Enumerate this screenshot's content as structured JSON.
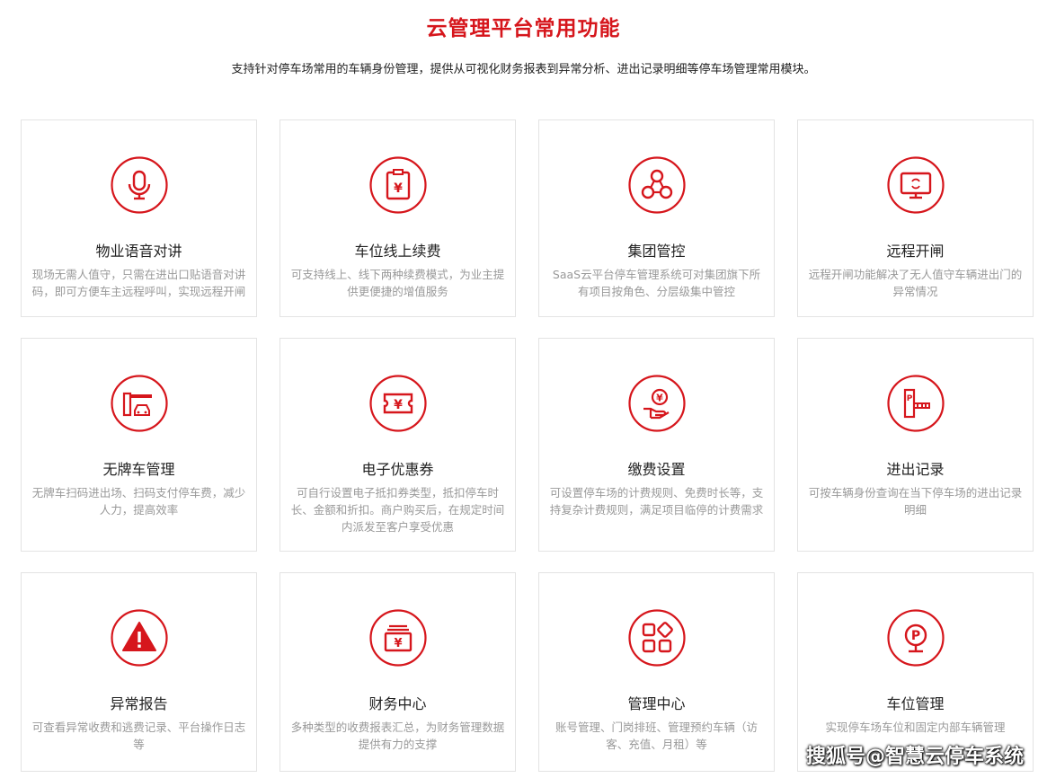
{
  "header": {
    "title": "云管理平台常用功能",
    "subtitle": "支持针对停车场常用的车辆身份管理，提供从可视化财务报表到异常分析、进出记录明细等停车场管理常用模块。"
  },
  "colors": {
    "accent": "#d6161c",
    "desc": "#999999",
    "border": "#e3e3e3"
  },
  "features": [
    {
      "icon": "microphone-icon",
      "name": "物业语音对讲",
      "desc": "现场无需人值守，只需在进出口贴语音对讲码，即可方便车主远程呼叫，实现远程开闸"
    },
    {
      "icon": "bill-icon",
      "name": "车位线上续费",
      "desc": "可支持线上、线下两种续费模式，为业主提供更便捷的增值服务"
    },
    {
      "icon": "group-icon",
      "name": "集团管控",
      "desc": "SaaS云平台停车管理系统可对集团旗下所有项目按角色、分层级集中管控"
    },
    {
      "icon": "monitor-icon",
      "name": "远程开闸",
      "desc": "远程开闸功能解决了无人值守车辆进出门的异常情况"
    },
    {
      "icon": "barrier-car-icon",
      "name": "无牌车管理",
      "desc": "无牌车扫码进出场、扫码支付停车费，减少人力，提高效率"
    },
    {
      "icon": "coupon-icon",
      "name": "电子优惠券",
      "desc": "可自行设置电子抵扣券类型，抵扣停车时长、金额和折扣。商户购买后，在规定时间内派发至客户享受优惠"
    },
    {
      "icon": "payment-hand-icon",
      "name": "缴费设置",
      "desc": "可设置停车场的计费规则、免费时长等，支持复杂计费规则，满足项目临停的计费需求"
    },
    {
      "icon": "parking-gate-icon",
      "name": "进出记录",
      "desc": "可按车辆身份查询在当下停车场的进出记录明细"
    },
    {
      "icon": "warning-icon",
      "name": "异常报告",
      "desc": "可查看异常收费和逃费记录、平台操作日志等"
    },
    {
      "icon": "finance-icon",
      "name": "财务中心",
      "desc": "多种类型的收费报表汇总，为财务管理数据提供有力的支撑"
    },
    {
      "icon": "apps-icon",
      "name": "管理中心",
      "desc": "账号管理、门岗排班、管理预约车辆（访客、充值、月租）等"
    },
    {
      "icon": "parking-icon",
      "name": "车位管理",
      "desc": "实现停车场车位和固定内部车辆管理"
    }
  ],
  "watermark": "搜狐号@智慧云停车系统"
}
